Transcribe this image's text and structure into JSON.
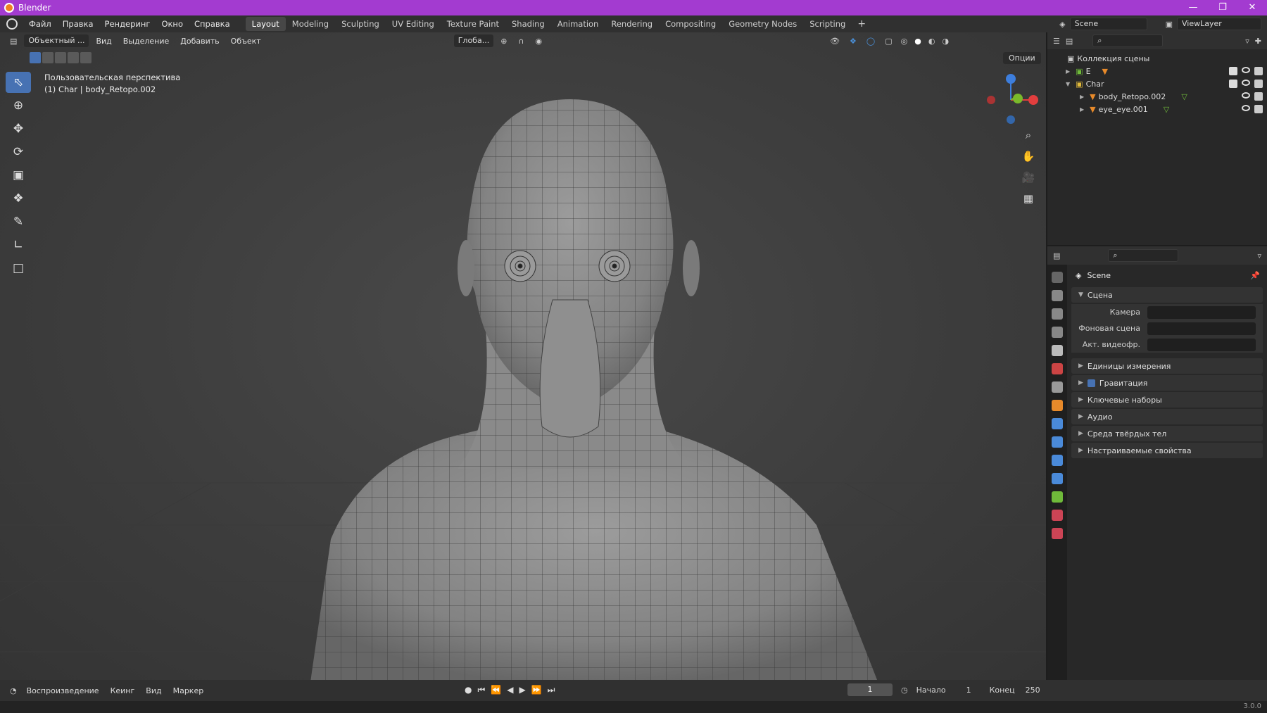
{
  "window": {
    "title": "Blender"
  },
  "menu": [
    "Файл",
    "Правка",
    "Рендеринг",
    "Окно",
    "Справка"
  ],
  "workspaces": [
    "Layout",
    "Modeling",
    "Sculpting",
    "UV Editing",
    "Texture Paint",
    "Shading",
    "Animation",
    "Rendering",
    "Compositing",
    "Geometry Nodes",
    "Scripting"
  ],
  "active_workspace": "Layout",
  "scene_name": "Scene",
  "view_layer": "ViewLayer",
  "viewport": {
    "mode": "Объектный ...",
    "menus": [
      "Вид",
      "Выделение",
      "Добавить",
      "Объект"
    ],
    "transform_orientation": "Глоба...",
    "options_label": "Опции",
    "info_line1": "Пользовательская перспектива",
    "info_line2": "(1) Char | body_Retopo.002"
  },
  "outliner": {
    "root": "Коллекция сцены",
    "items": [
      {
        "label": "E",
        "indent": 0
      },
      {
        "label": "Char",
        "indent": 0
      },
      {
        "label": "body_Retopo.002",
        "indent": 1
      },
      {
        "label": "eye_eye.001",
        "indent": 1
      }
    ]
  },
  "properties": {
    "title": "Scene",
    "section": "Сцена",
    "fields": [
      {
        "label": "Камера"
      },
      {
        "label": "Фоновая сцена"
      },
      {
        "label": "Акт. видеофр."
      }
    ],
    "panels": [
      "Единицы измерения",
      "Гравитация",
      "Ключевые наборы",
      "Аудио",
      "Среда твёрдых тел",
      "Настраиваемые свойства"
    ]
  },
  "timeline": {
    "menus": [
      "Воспроизведение",
      "Кеинг",
      "Вид",
      "Маркер"
    ],
    "current_frame": "1",
    "start_label": "Начало",
    "start_value": "1",
    "end_label": "Конец",
    "end_value": "250"
  },
  "version": "3.0.0",
  "colors": {
    "accent": "#4772b3",
    "titlebar": "#a33bd0",
    "axis_x": "#e23e3e",
    "axis_y": "#7ab92b",
    "axis_z": "#3d7edd"
  }
}
